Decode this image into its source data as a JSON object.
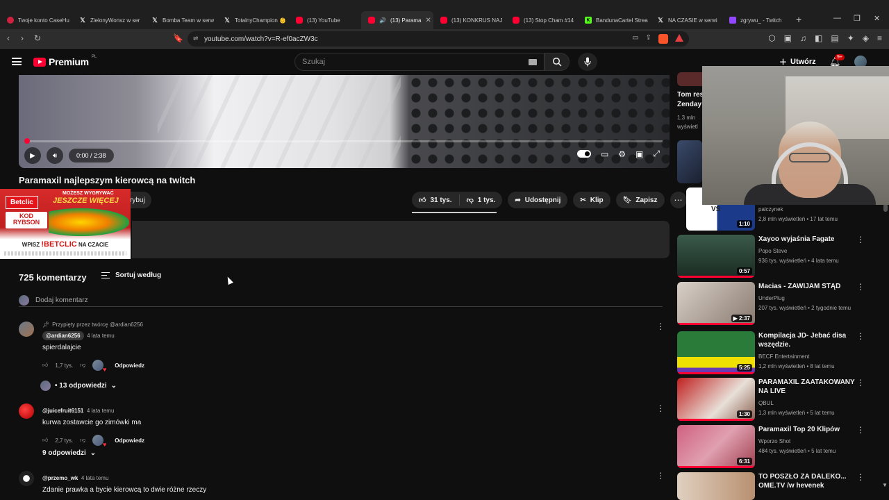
{
  "browser": {
    "tabs": [
      {
        "label": "Twoje konto CaseHu",
        "icon": "casehug"
      },
      {
        "label": "ZielonyWonsz w ser",
        "icon": "x"
      },
      {
        "label": "Bomba Team w serw",
        "icon": "x"
      },
      {
        "label": "TotalnyChampion 👶",
        "icon": "x"
      },
      {
        "label": "(13) YouTube",
        "icon": "yt"
      },
      {
        "label": "(13) Parama",
        "icon": "yt",
        "active": true
      },
      {
        "label": "(13) KONKRUS NAJ",
        "icon": "yt"
      },
      {
        "label": "(13) Stop Cham #14",
        "icon": "yt"
      },
      {
        "label": "BandunaCartel Strea",
        "icon": "kick"
      },
      {
        "label": "NA CZASIE w serwi",
        "icon": "x"
      },
      {
        "label": "zgrywu_ - Twitch",
        "icon": "twitch"
      }
    ],
    "url": "youtube.com/watch?v=R-ef0acZW3c"
  },
  "yt": {
    "logo_text": "Premium",
    "logo_region": "PL",
    "search_placeholder": "Szukaj",
    "create_label": "Utwórz",
    "notif_badge": "9+"
  },
  "player": {
    "time": "0:00 / 2:38",
    "progress_fraction": 0.0
  },
  "video": {
    "title": "Paramaxil najlepszym kierowcą na twitch",
    "subscribe_label": "rybuj",
    "likes": "31 tys.",
    "dislikes": "1 tys.",
    "share_label": "Udostępnij",
    "clip_label": "Klip",
    "save_label": "Zapisz"
  },
  "ad": {
    "brand": "Betclic",
    "slogan_top": "MOŻESZ WYGRYWAĆ",
    "slogan_main": "JESZCZE WIĘCEJ",
    "code_label": "KOD",
    "code": "RYBSON",
    "cta_pre": "WPISZ",
    "cta_code": "!BETCLIC",
    "cta_post": "NA CZACIE"
  },
  "comments": {
    "count_label": "725 komentarzy",
    "sort_label": "Sortuj według",
    "add_placeholder": "Dodaj komentarz",
    "reply_label": "Odpowiedz",
    "items": [
      {
        "pinned": "Przypięty przez twórcę @ardian6256",
        "author": "@ardian6256",
        "time": "4 lata temu",
        "text": "spierdalajcie",
        "likes": "1,7 tys.",
        "replies": "• 13 odpowiedzi"
      },
      {
        "author": "@juicefruit6151",
        "time": "4 lata temu",
        "text": "kurwa zostawcie go zimówki ma",
        "likes": "2,7 tys.",
        "replies": "9 odpowiedzi"
      },
      {
        "author": "@przemo_wk",
        "time": "4 lata temu",
        "text": "Zdanie prawka a bycie kierowcą to dwie różne rzeczy"
      }
    ]
  },
  "sidebar": {
    "partial_top": {
      "title_line1": "Tom res",
      "title_line2": "Zenday",
      "stat": "1,3 mln",
      "stat2": "wyświetl"
    },
    "first_partial": {
      "channel": "palczynek",
      "stats": "2,8 mln wyświetleń • 17 lat temu",
      "duration": "1:10",
      "thumb_text": "VS"
    },
    "items": [
      {
        "title": "Xayoo wyjaśnia Fagate",
        "channel": "Popo Steve",
        "stats": "936 tys. wyświetleń • 4 lata temu",
        "duration": "0:57"
      },
      {
        "title": "Macias - ZAWIJAM STĄD",
        "channel": "UnderPlug",
        "stats": "207 tys. wyświetleń • 2 tygodnie temu",
        "duration": "2:37"
      },
      {
        "title": "Kompilacja JD- Jebać disa wszędzie.",
        "channel": "BECF Entertainment",
        "stats": "1,2 mln wyświetleń • 8 lat temu",
        "duration": "5:25"
      },
      {
        "title": "PARAMAXIL ZAATAKOWANY NA LIVE",
        "channel": "QBUL",
        "stats": "1,3 mln wyświetleń • 5 lat temu",
        "duration": "1:30"
      },
      {
        "title": "Paramaxil Top 20 Klipów",
        "channel": "Wporzo Shot",
        "stats": "484 tys. wyświetleń • 5 lat temu",
        "duration": "6:31"
      },
      {
        "title": "TO POSZŁO ZA DALEKO... OME.TV /w hevenek",
        "channel": "",
        "stats": "",
        "duration": ""
      }
    ]
  }
}
